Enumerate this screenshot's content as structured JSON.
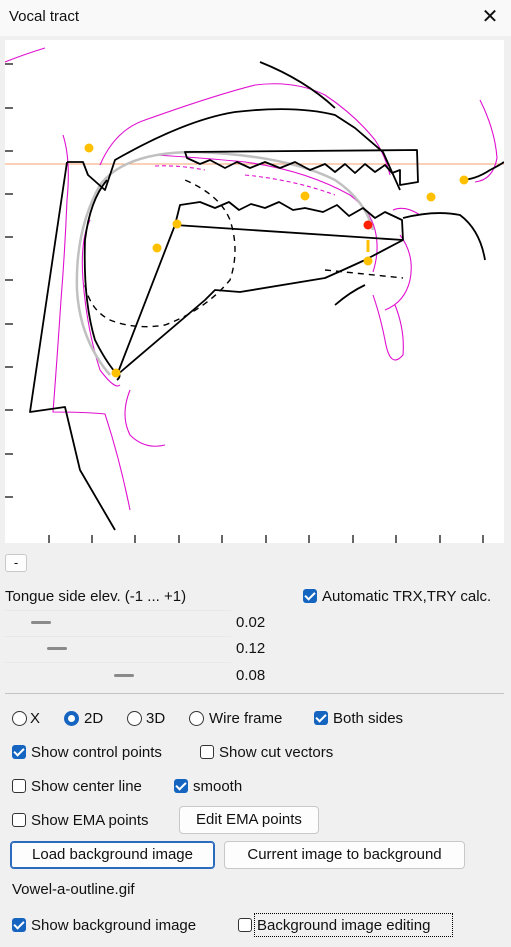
{
  "window": {
    "title": "Vocal tract"
  },
  "collapse_button": "-",
  "tongue": {
    "label": "Tongue side elev. (-1 ... +1)",
    "sliders": [
      {
        "value_text": "0.02",
        "value": 0.02
      },
      {
        "value_text": "0.12",
        "value": 0.12
      },
      {
        "value_text": "0.08",
        "value": 0.08
      }
    ]
  },
  "auto_calc": {
    "label": "Automatic TRX,TRY calc.",
    "checked": true
  },
  "view_modes": [
    {
      "label": "X",
      "selected": false
    },
    {
      "label": "2D",
      "selected": true
    },
    {
      "label": "3D",
      "selected": false
    },
    {
      "label": "Wire frame",
      "selected": false
    }
  ],
  "options": {
    "both_sides": "Both sides",
    "show_control_points": "Show control points",
    "show_cut_vectors": "Show cut vectors",
    "show_center_line": "Show center line",
    "smooth": "smooth",
    "show_ema_points": "Show EMA points",
    "show_background_image": "Show background image",
    "background_image_editing": "Background image editing"
  },
  "buttons": {
    "edit_ema_points": "Edit EMA points",
    "load_background_image": "Load background image",
    "current_image_to_background": "Current image to background"
  },
  "background_file": "Vowel-a-outline.gif",
  "colors": {
    "accent": "#1565c0",
    "control_point": "#ffc000",
    "selected_point": "#ff2000",
    "outline_magenta": "#e010d0",
    "reference_line": "#f4a070"
  }
}
